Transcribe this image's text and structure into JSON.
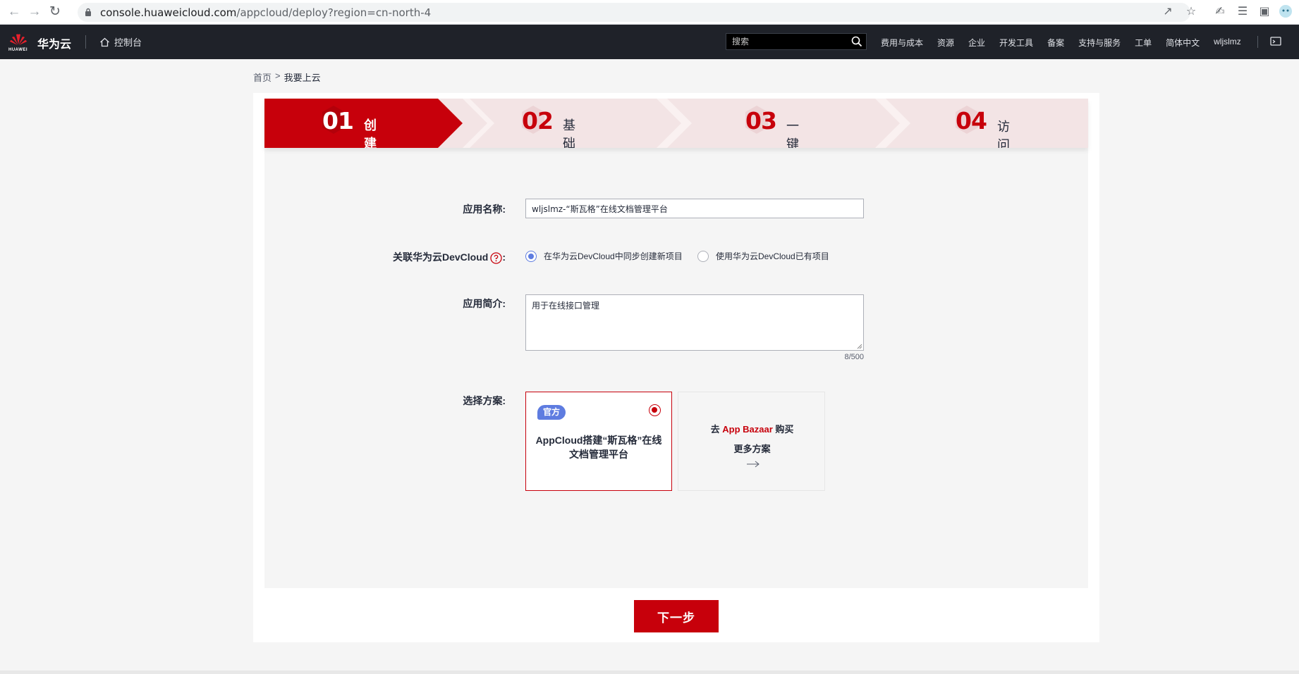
{
  "browser": {
    "url_host": "console.huaweicloud.com",
    "url_path": "/appcloud/deploy?region=cn-north-4"
  },
  "header": {
    "logo_text": "HUAWEI",
    "brand": "华为云",
    "console": "控制台",
    "search_placeholder": "搜索",
    "nav": [
      "费用与成本",
      "资源",
      "企业",
      "开发工具",
      "备案",
      "支持与服务",
      "工单",
      "简体中文"
    ],
    "user": "wljslmz"
  },
  "breadcrumb": {
    "home": "首页",
    "sep": ">",
    "current": "我要上云"
  },
  "steps": [
    {
      "num": "01",
      "label": "创建应用"
    },
    {
      "num": "02",
      "label": "基础设置"
    },
    {
      "num": "03",
      "label": "一键部署"
    },
    {
      "num": "04",
      "label": "访问应用"
    }
  ],
  "form": {
    "app_name_label": "应用名称:",
    "app_name_value": "wljslmz-“斯瓦格”在线文档管理平台",
    "devcloud_label": "关联华为云DevCloud",
    "devcloud_colon": ":",
    "devcloud_options": [
      "在华为云DevCloud中同步创建新项目",
      "使用华为云DevCloud已有项目"
    ],
    "desc_label": "应用简介:",
    "desc_value": "用于在线接口管理",
    "desc_counter": "8/500",
    "plan_label": "选择方案:",
    "plan_badge": "官方",
    "plan_title": "AppCloud搭建“斯瓦格”在线文档管理平台",
    "more_prefix": "去 ",
    "more_bazaar": "App Bazaar",
    "more_suffix": " 购买",
    "more_line2": "更多方案"
  },
  "next_button": "下一步",
  "colors": {
    "brand_red": "#c7000b",
    "header_dark": "#1f2229",
    "accent_blue": "#5e7ce0",
    "step_pink": "#f3e4e5"
  }
}
